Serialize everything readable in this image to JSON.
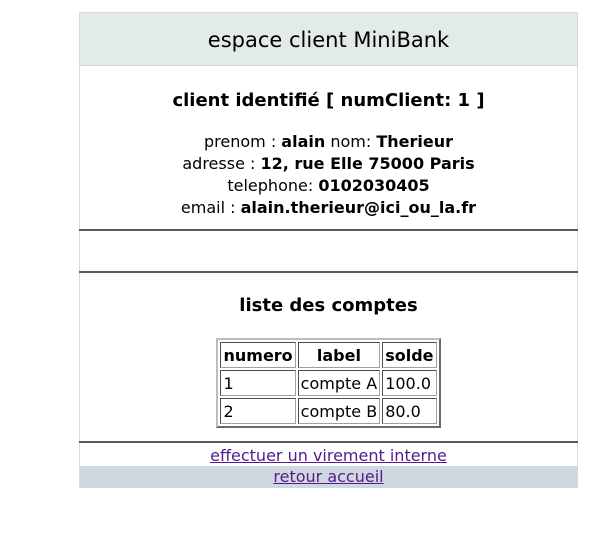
{
  "header": {
    "title": "espace client MiniBank"
  },
  "client": {
    "title": "client identifié [ numClient: 1 ]",
    "prenom_label": "prenom : ",
    "prenom": "alain",
    "nom_label": " nom: ",
    "nom": "Therieur",
    "adresse_label": "adresse : ",
    "adresse": "12, rue Elle 75000 Paris",
    "telephone_label": "telephone: ",
    "telephone": "0102030405",
    "email_label": "email : ",
    "email": "alain.therieur@ici_ou_la.fr"
  },
  "accounts": {
    "title": "liste des comptes",
    "columns": [
      "numero",
      "label",
      "solde"
    ],
    "rows": [
      [
        "1",
        "compte A",
        "100.0"
      ],
      [
        "2",
        "compte B",
        "80.0"
      ]
    ]
  },
  "links": {
    "virement": "effectuer un virement interne",
    "accueil": "retour accueil"
  },
  "colors": {
    "header_bg": "#e3ebea",
    "footer_bg": "#d0d8df",
    "link": "#551a8b"
  }
}
